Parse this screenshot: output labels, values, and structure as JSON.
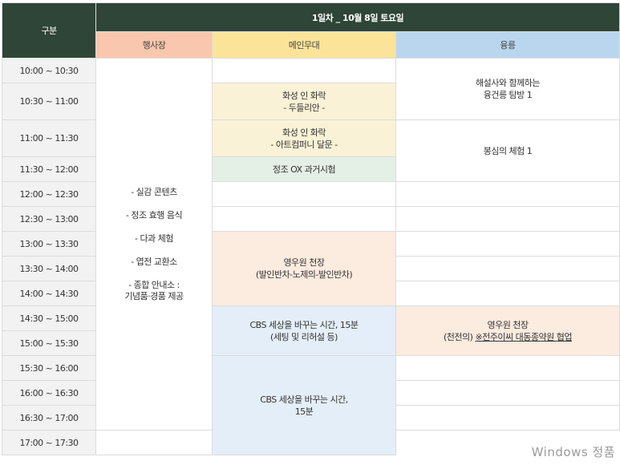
{
  "header": {
    "category": "구분",
    "day_title": "1일차 _ 10월 8일 토요일",
    "col_event": "행사장",
    "col_main": "메인무대",
    "col_tomb": "융릉"
  },
  "times": [
    "10:00 ~ 10:30",
    "10:30 ~ 11:00",
    "11:00 ~ 11:30",
    "11:30 ~ 12:00",
    "12:00 ~ 12:30",
    "12:30 ~ 13:00",
    "13:00 ~ 13:30",
    "13:30 ~ 14:00",
    "14:00 ~ 14:30",
    "14:30 ~ 15:00",
    "15:00 ~ 15:30",
    "15:30 ~ 16:00",
    "16:00 ~ 16:30",
    "16:30 ~ 17:00",
    "17:00 ~ 17:30"
  ],
  "event_hall": {
    "items": [
      "- 실감 콘텐츠",
      "- 정조 효행 음식",
      "- 다과 체험",
      "- 엽전 교환소",
      "- 종합 안내소 :",
      "기념품·경품 제공"
    ]
  },
  "main_stage": {
    "block1": {
      "line1": "화성 인 화락",
      "line2": "- 두들리안 -"
    },
    "block2": {
      "line1": "화성 인 화락",
      "line2": "- 아트컴퍼니 달문 -"
    },
    "block3": "정조 OX 과거시험",
    "block4": {
      "line1": "영우원 천장",
      "line2": "(발인반차-노제의-발인반차)"
    },
    "block5": {
      "line1": "CBS 세상을 바꾸는 시간, 15분",
      "line2": "(세팅 및 리허설 등)"
    },
    "block6": {
      "line1": "CBS 세상을 바꾸는 시간,",
      "line2": "15분"
    }
  },
  "tomb": {
    "block1": {
      "line1": "해설사와 함께하는",
      "line2": "융건릉 탐방 1"
    },
    "block2": "봉심의 체험 1",
    "block3": {
      "line1": "영우원 천장",
      "line2_a": "(천전의) ",
      "line2_b": "※전주이씨 대동종약원 협업"
    }
  },
  "watermark": "Windows 정품"
}
